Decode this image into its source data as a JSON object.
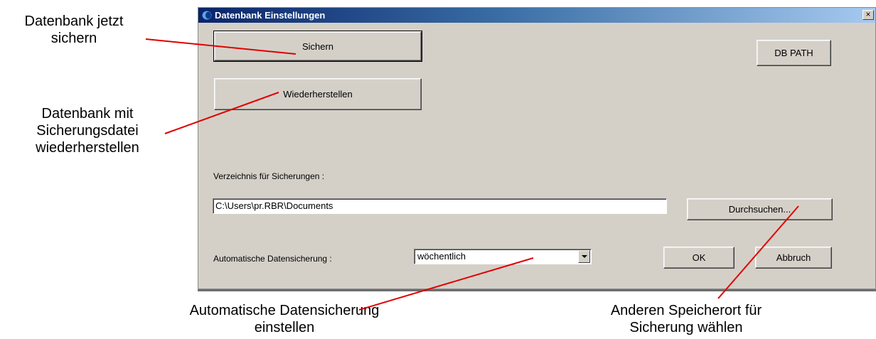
{
  "dialog": {
    "title": "Datenbank Einstellungen",
    "close_label": "×",
    "buttons": {
      "backup": "Sichern",
      "restore": "Wiederherstellen",
      "db_path": "DB PATH",
      "browse": "Durchsuchen...",
      "ok": "OK",
      "cancel": "Abbruch"
    },
    "directory_label": "Verzeichnis für Sicherungen :",
    "directory_value": "C:\\Users\\pr.RBR\\Documents",
    "auto_backup_label": "Automatische Datensicherung :",
    "auto_backup_value": "wöchentlich"
  },
  "annotations": {
    "backup": "Datenbank jetzt sichern",
    "restore": "Datenbank mit Sicherungsdatei wiederherstellen",
    "auto_backup": "Automatische Datensicherung einstellen",
    "location": "Anderen Speicherort für Sicherung wählen"
  },
  "colors": {
    "dialog_bg": "#d4d0c8",
    "titlebar_start": "#0a246a",
    "titlebar_end": "#a6caf0",
    "annotation_line": "#e00000"
  }
}
